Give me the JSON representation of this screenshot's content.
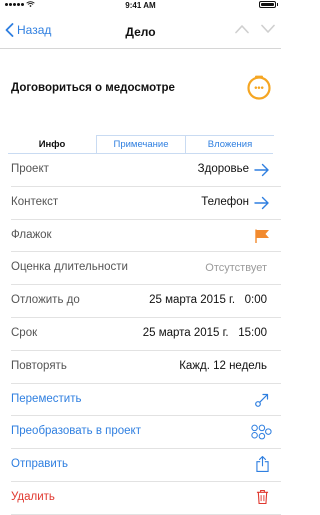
{
  "status_bar": {
    "time": "9:41 AM"
  },
  "nav": {
    "back_label": "Назад",
    "title": "Дело"
  },
  "task": {
    "title": "Договориться о медосмотре",
    "status_dots": "•••"
  },
  "tabs": [
    {
      "label": "Инфо",
      "active": true
    },
    {
      "label": "Примечание",
      "active": false
    },
    {
      "label": "Вложения",
      "active": false
    }
  ],
  "rows": {
    "project": {
      "label": "Проект",
      "value": "Здоровье",
      "icon": "arrow-right-icon"
    },
    "context": {
      "label": "Контекст",
      "value": "Телефон",
      "icon": "arrow-right-icon"
    },
    "flag": {
      "label": "Флажок",
      "icon": "flag-icon"
    },
    "duration": {
      "label": "Оценка длительности",
      "value": "Отсутствует"
    },
    "defer": {
      "label": "Отложить до",
      "value": "25 марта 2015 г.   0:00"
    },
    "due": {
      "label": "Срок",
      "value": "25 марта 2015 г.   15:00"
    },
    "repeat": {
      "label": "Повторять",
      "value": "Кажд. 12 недель"
    }
  },
  "actions": {
    "move": {
      "label": "Переместить",
      "icon": "move-icon"
    },
    "convert": {
      "label": "Преобразовать в проект",
      "icon": "project-icon"
    },
    "send": {
      "label": "Отправить",
      "icon": "share-icon"
    },
    "delete": {
      "label": "Удалить",
      "icon": "trash-icon"
    }
  },
  "colors": {
    "accent": "#2f7fe0",
    "flag": "#f28a2e",
    "status_ring": "#f5a623",
    "destructive": "#e0382f"
  }
}
